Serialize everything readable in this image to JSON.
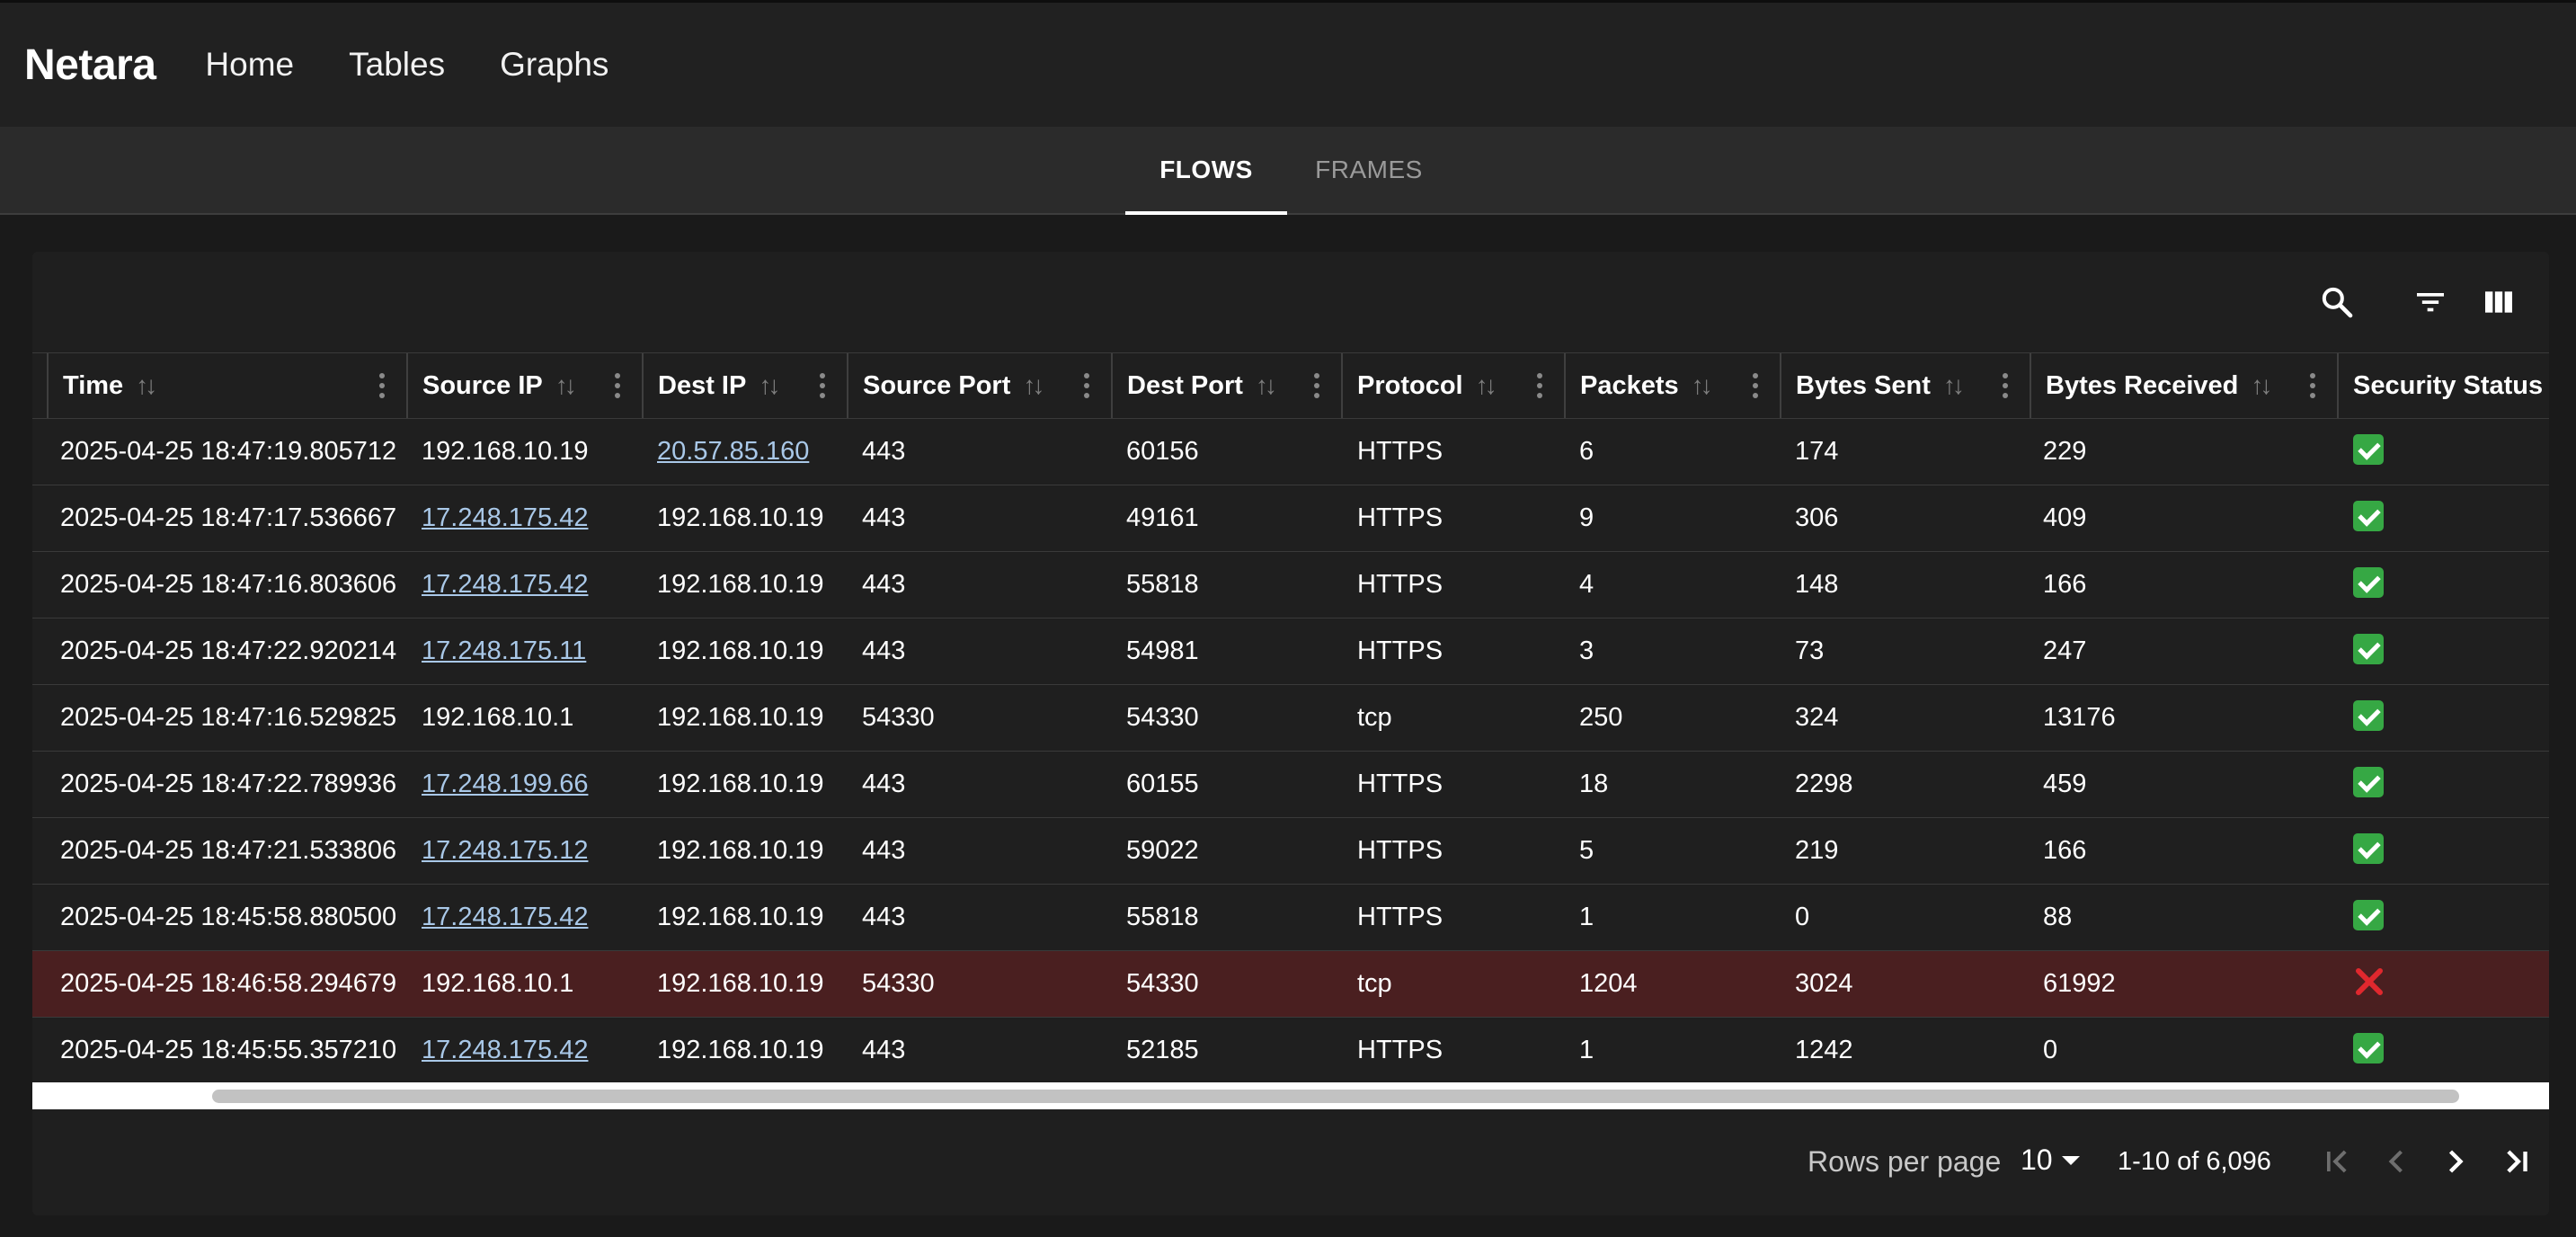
{
  "app": {
    "brand": "Netara",
    "nav": [
      "Home",
      "Tables",
      "Graphs"
    ]
  },
  "tabs": [
    {
      "label": "FLOWS",
      "active": true
    },
    {
      "label": "FRAMES",
      "active": false
    }
  ],
  "toolbar": {
    "icons": [
      "search-icon",
      "filter-icon",
      "columns-icon"
    ]
  },
  "table": {
    "columns": [
      "Time",
      "Source IP",
      "Dest IP",
      "Source Port",
      "Dest Port",
      "Protocol",
      "Packets",
      "Bytes Sent",
      "Bytes Received",
      "Security Status"
    ],
    "rows": [
      {
        "time": "2025-04-25 18:47:19.805712",
        "src": "192.168.10.19",
        "src_link": false,
        "dst": "20.57.85.160",
        "dst_link": true,
        "sport": "443",
        "dport": "60156",
        "proto": "HTTPS",
        "packets": "6",
        "sent": "174",
        "recv": "229",
        "status": "ok"
      },
      {
        "time": "2025-04-25 18:47:17.536667",
        "src": "17.248.175.42",
        "src_link": true,
        "dst": "192.168.10.19",
        "dst_link": false,
        "sport": "443",
        "dport": "49161",
        "proto": "HTTPS",
        "packets": "9",
        "sent": "306",
        "recv": "409",
        "status": "ok"
      },
      {
        "time": "2025-04-25 18:47:16.803606",
        "src": "17.248.175.42",
        "src_link": true,
        "dst": "192.168.10.19",
        "dst_link": false,
        "sport": "443",
        "dport": "55818",
        "proto": "HTTPS",
        "packets": "4",
        "sent": "148",
        "recv": "166",
        "status": "ok"
      },
      {
        "time": "2025-04-25 18:47:22.920214",
        "src": "17.248.175.11",
        "src_link": true,
        "dst": "192.168.10.19",
        "dst_link": false,
        "sport": "443",
        "dport": "54981",
        "proto": "HTTPS",
        "packets": "3",
        "sent": "73",
        "recv": "247",
        "status": "ok"
      },
      {
        "time": "2025-04-25 18:47:16.529825",
        "src": "192.168.10.1",
        "src_link": false,
        "dst": "192.168.10.19",
        "dst_link": false,
        "sport": "54330",
        "dport": "54330",
        "proto": "tcp",
        "packets": "250",
        "sent": "324",
        "recv": "13176",
        "status": "ok"
      },
      {
        "time": "2025-04-25 18:47:22.789936",
        "src": "17.248.199.66",
        "src_link": true,
        "dst": "192.168.10.19",
        "dst_link": false,
        "sport": "443",
        "dport": "60155",
        "proto": "HTTPS",
        "packets": "18",
        "sent": "2298",
        "recv": "459",
        "status": "ok"
      },
      {
        "time": "2025-04-25 18:47:21.533806",
        "src": "17.248.175.12",
        "src_link": true,
        "dst": "192.168.10.19",
        "dst_link": false,
        "sport": "443",
        "dport": "59022",
        "proto": "HTTPS",
        "packets": "5",
        "sent": "219",
        "recv": "166",
        "status": "ok"
      },
      {
        "time": "2025-04-25 18:45:58.880500",
        "src": "17.248.175.42",
        "src_link": true,
        "dst": "192.168.10.19",
        "dst_link": false,
        "sport": "443",
        "dport": "55818",
        "proto": "HTTPS",
        "packets": "1",
        "sent": "0",
        "recv": "88",
        "status": "ok"
      },
      {
        "time": "2025-04-25 18:46:58.294679",
        "src": "192.168.10.1",
        "src_link": false,
        "dst": "192.168.10.19",
        "dst_link": false,
        "sport": "54330",
        "dport": "54330",
        "proto": "tcp",
        "packets": "1204",
        "sent": "3024",
        "recv": "61992",
        "status": "bad"
      },
      {
        "time": "2025-04-25 18:45:55.357210",
        "src": "17.248.175.42",
        "src_link": true,
        "dst": "192.168.10.19",
        "dst_link": false,
        "sport": "443",
        "dport": "52185",
        "proto": "HTTPS",
        "packets": "1",
        "sent": "1242",
        "recv": "0",
        "status": "ok"
      }
    ]
  },
  "pagination": {
    "rows_per_page_label": "Rows per page",
    "rows_per_page": "10",
    "range": "1-10 of 6,096"
  },
  "colors": {
    "alert_row": "#4a1f20",
    "ok": "#36a844",
    "bad": "#e0282e",
    "link": "#a9c8e8"
  }
}
